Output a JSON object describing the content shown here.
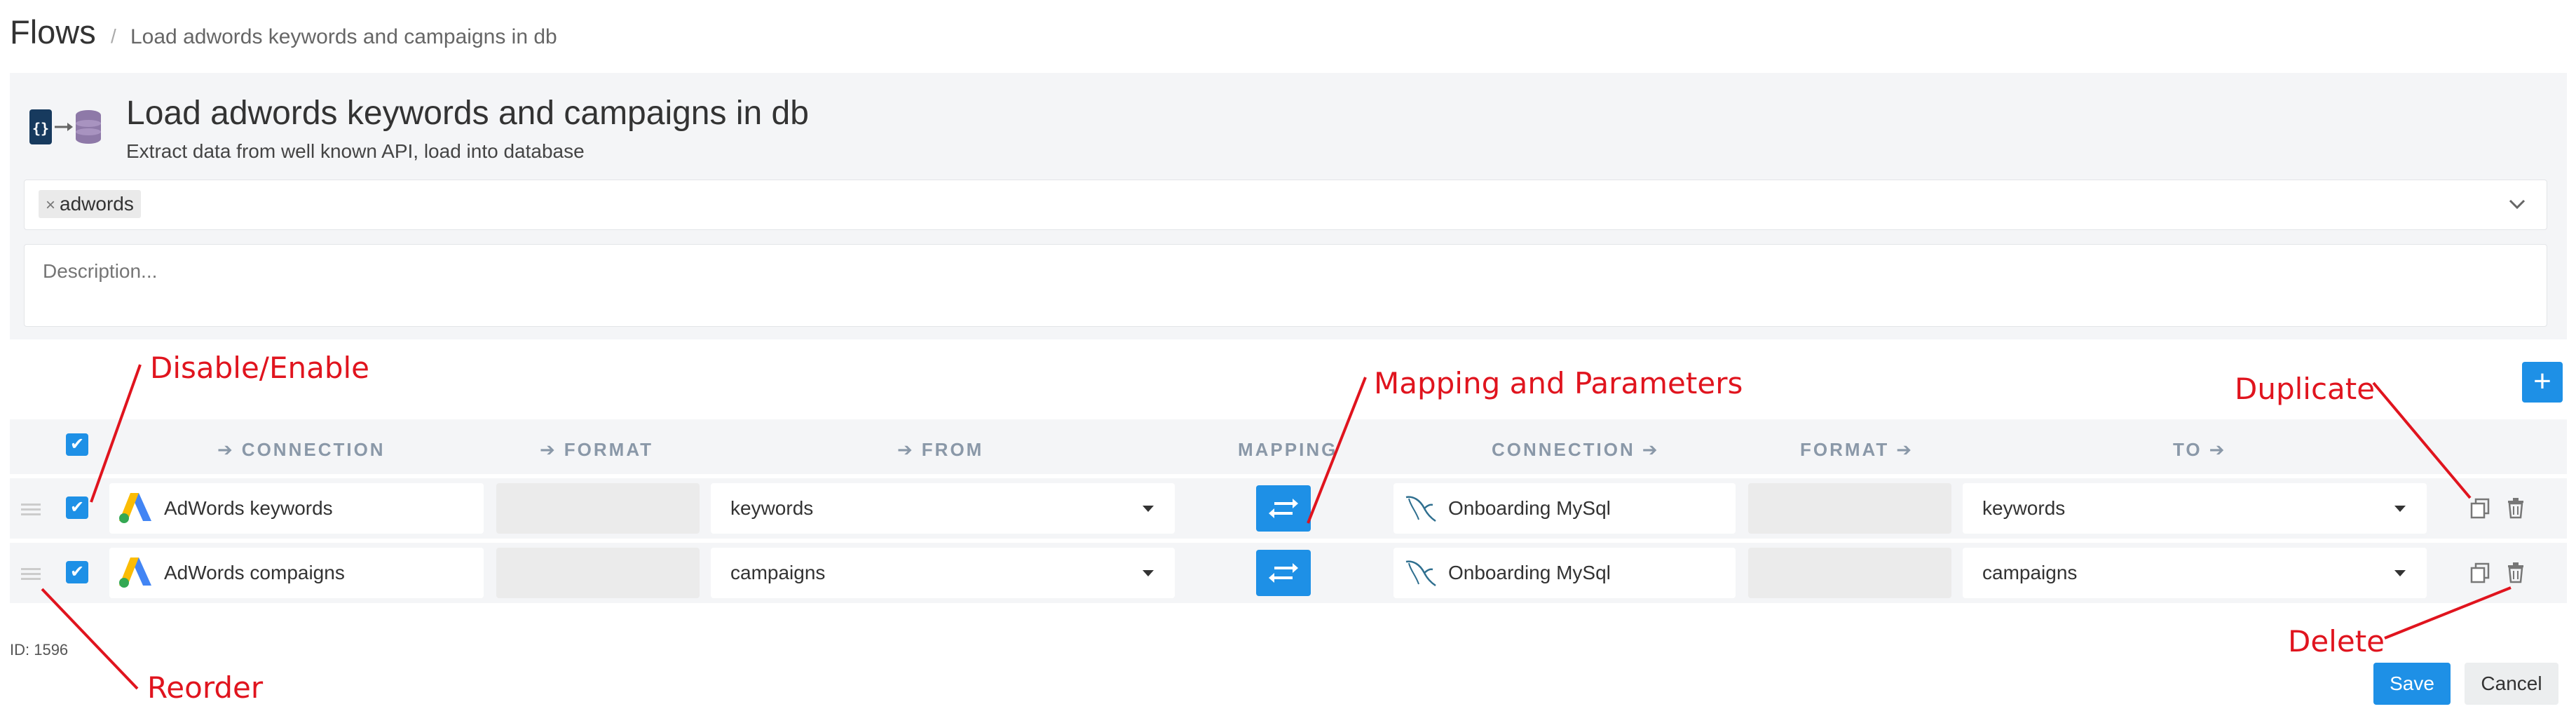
{
  "breadcrumb": {
    "root": "Flows",
    "separator": "/",
    "current": "Load adwords keywords and campaigns in db"
  },
  "flow": {
    "title": "Load adwords keywords and campaigns in db",
    "subtitle": "Extract data from well known API, load into database",
    "tags": [
      {
        "label": "adwords",
        "remove": "×"
      }
    ],
    "description_placeholder": "Description..."
  },
  "table": {
    "headers": {
      "src_connection": "CONNECTION",
      "src_format": "FORMAT",
      "from": "FROM",
      "mapping": "MAPPING",
      "dst_connection": "CONNECTION",
      "dst_format": "FORMAT",
      "to": "TO"
    },
    "rows": [
      {
        "enabled": true,
        "source": "AdWords keywords",
        "from": "keywords",
        "destination": "Onboarding MySql",
        "to": "keywords"
      },
      {
        "enabled": true,
        "source": "AdWords compaigns",
        "from": "campaigns",
        "destination": "Onboarding MySql",
        "to": "campaigns"
      }
    ]
  },
  "footer": {
    "id_label": "ID: 1596",
    "save_label": "Save",
    "cancel_label": "Cancel"
  },
  "annotations": {
    "disable_enable": "Disable/Enable",
    "mapping_params": "Mapping and Parameters",
    "duplicate": "Duplicate",
    "reorder": "Reorder",
    "delete": "Delete"
  },
  "colors": {
    "accent": "#1e90e6",
    "panel_bg": "#f4f5f7",
    "annotation": "#e0141e",
    "header_text": "#8a98a8"
  },
  "icons": {
    "add": "plus-icon",
    "check": "check-icon",
    "mapping": "swap-arrows-icon",
    "source": "adwords-logo-icon",
    "destination": "mysql-dolphin-icon",
    "duplicate": "copy-icon",
    "delete": "trash-icon",
    "reorder": "drag-handle-icon"
  }
}
